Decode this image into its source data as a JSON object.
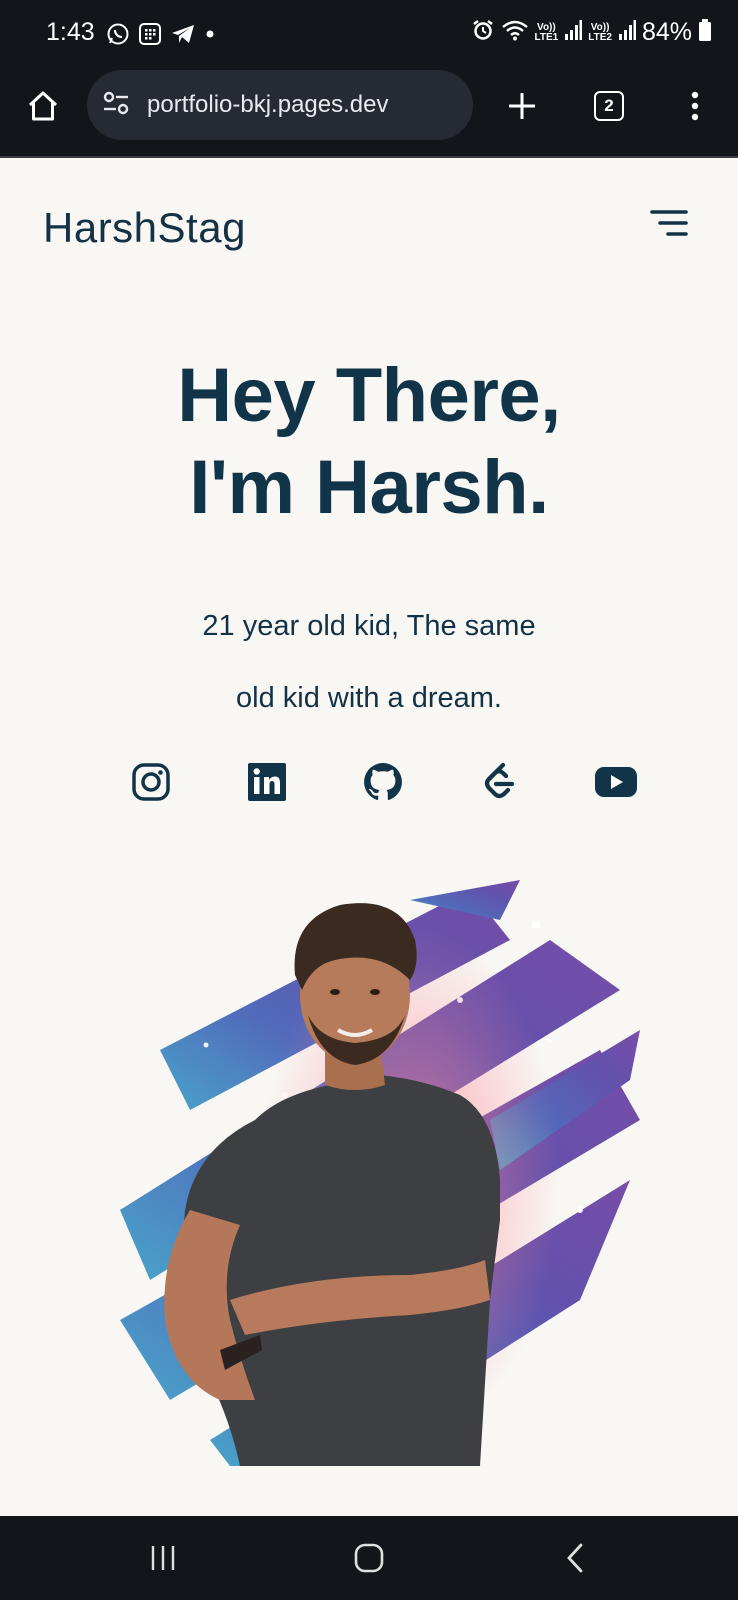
{
  "status_bar": {
    "time": "1:43",
    "battery": "84%",
    "sim1": "LTE1",
    "sim2": "LTE2",
    "left_icons": [
      "whatsapp-icon",
      "sim-toolkit-icon",
      "telegram-icon",
      "dot-icon"
    ],
    "right_icons": [
      "alarm-icon",
      "wifi-icon",
      "signal-1-icon",
      "signal-2-icon",
      "battery-icon"
    ]
  },
  "browser": {
    "url": "portfolio-bkj.pages.dev",
    "tab_count": "2",
    "icons": [
      "home-icon",
      "site-settings-icon",
      "new-tab-icon",
      "tabs-icon",
      "more-menu-icon"
    ]
  },
  "page": {
    "brand": "HarshStag",
    "headline_line1": "Hey There,",
    "headline_line2": "I'm Harsh.",
    "tagline_line1": "21 year old kid, The same",
    "tagline_line2": "old kid with a dream.",
    "socials": [
      "instagram-icon",
      "linkedin-icon",
      "github-icon",
      "leetcode-icon",
      "youtube-icon"
    ],
    "colors": {
      "text": "#123449",
      "background": "#f8f7f4",
      "splash_purple": "#6a44a8",
      "splash_blue": "#4a63b8",
      "splash_teal": "#3fa0c8"
    }
  },
  "nav_bar": {
    "icons": [
      "recents-icon",
      "home-nav-icon",
      "back-icon"
    ]
  }
}
